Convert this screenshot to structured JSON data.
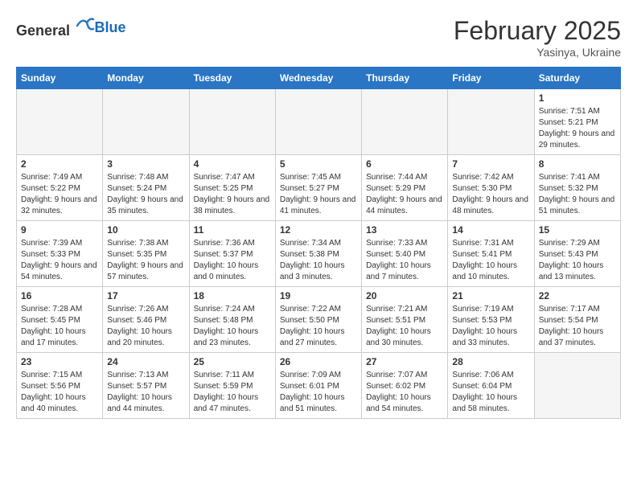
{
  "header": {
    "logo_general": "General",
    "logo_blue": "Blue",
    "title": "February 2025",
    "subtitle": "Yasinya, Ukraine"
  },
  "weekdays": [
    "Sunday",
    "Monday",
    "Tuesday",
    "Wednesday",
    "Thursday",
    "Friday",
    "Saturday"
  ],
  "weeks": [
    [
      {
        "day": "",
        "info": ""
      },
      {
        "day": "",
        "info": ""
      },
      {
        "day": "",
        "info": ""
      },
      {
        "day": "",
        "info": ""
      },
      {
        "day": "",
        "info": ""
      },
      {
        "day": "",
        "info": ""
      },
      {
        "day": "1",
        "info": "Sunrise: 7:51 AM\nSunset: 5:21 PM\nDaylight: 9 hours and 29 minutes."
      }
    ],
    [
      {
        "day": "2",
        "info": "Sunrise: 7:49 AM\nSunset: 5:22 PM\nDaylight: 9 hours and 32 minutes."
      },
      {
        "day": "3",
        "info": "Sunrise: 7:48 AM\nSunset: 5:24 PM\nDaylight: 9 hours and 35 minutes."
      },
      {
        "day": "4",
        "info": "Sunrise: 7:47 AM\nSunset: 5:25 PM\nDaylight: 9 hours and 38 minutes."
      },
      {
        "day": "5",
        "info": "Sunrise: 7:45 AM\nSunset: 5:27 PM\nDaylight: 9 hours and 41 minutes."
      },
      {
        "day": "6",
        "info": "Sunrise: 7:44 AM\nSunset: 5:29 PM\nDaylight: 9 hours and 44 minutes."
      },
      {
        "day": "7",
        "info": "Sunrise: 7:42 AM\nSunset: 5:30 PM\nDaylight: 9 hours and 48 minutes."
      },
      {
        "day": "8",
        "info": "Sunrise: 7:41 AM\nSunset: 5:32 PM\nDaylight: 9 hours and 51 minutes."
      }
    ],
    [
      {
        "day": "9",
        "info": "Sunrise: 7:39 AM\nSunset: 5:33 PM\nDaylight: 9 hours and 54 minutes."
      },
      {
        "day": "10",
        "info": "Sunrise: 7:38 AM\nSunset: 5:35 PM\nDaylight: 9 hours and 57 minutes."
      },
      {
        "day": "11",
        "info": "Sunrise: 7:36 AM\nSunset: 5:37 PM\nDaylight: 10 hours and 0 minutes."
      },
      {
        "day": "12",
        "info": "Sunrise: 7:34 AM\nSunset: 5:38 PM\nDaylight: 10 hours and 3 minutes."
      },
      {
        "day": "13",
        "info": "Sunrise: 7:33 AM\nSunset: 5:40 PM\nDaylight: 10 hours and 7 minutes."
      },
      {
        "day": "14",
        "info": "Sunrise: 7:31 AM\nSunset: 5:41 PM\nDaylight: 10 hours and 10 minutes."
      },
      {
        "day": "15",
        "info": "Sunrise: 7:29 AM\nSunset: 5:43 PM\nDaylight: 10 hours and 13 minutes."
      }
    ],
    [
      {
        "day": "16",
        "info": "Sunrise: 7:28 AM\nSunset: 5:45 PM\nDaylight: 10 hours and 17 minutes."
      },
      {
        "day": "17",
        "info": "Sunrise: 7:26 AM\nSunset: 5:46 PM\nDaylight: 10 hours and 20 minutes."
      },
      {
        "day": "18",
        "info": "Sunrise: 7:24 AM\nSunset: 5:48 PM\nDaylight: 10 hours and 23 minutes."
      },
      {
        "day": "19",
        "info": "Sunrise: 7:22 AM\nSunset: 5:50 PM\nDaylight: 10 hours and 27 minutes."
      },
      {
        "day": "20",
        "info": "Sunrise: 7:21 AM\nSunset: 5:51 PM\nDaylight: 10 hours and 30 minutes."
      },
      {
        "day": "21",
        "info": "Sunrise: 7:19 AM\nSunset: 5:53 PM\nDaylight: 10 hours and 33 minutes."
      },
      {
        "day": "22",
        "info": "Sunrise: 7:17 AM\nSunset: 5:54 PM\nDaylight: 10 hours and 37 minutes."
      }
    ],
    [
      {
        "day": "23",
        "info": "Sunrise: 7:15 AM\nSunset: 5:56 PM\nDaylight: 10 hours and 40 minutes."
      },
      {
        "day": "24",
        "info": "Sunrise: 7:13 AM\nSunset: 5:57 PM\nDaylight: 10 hours and 44 minutes."
      },
      {
        "day": "25",
        "info": "Sunrise: 7:11 AM\nSunset: 5:59 PM\nDaylight: 10 hours and 47 minutes."
      },
      {
        "day": "26",
        "info": "Sunrise: 7:09 AM\nSunset: 6:01 PM\nDaylight: 10 hours and 51 minutes."
      },
      {
        "day": "27",
        "info": "Sunrise: 7:07 AM\nSunset: 6:02 PM\nDaylight: 10 hours and 54 minutes."
      },
      {
        "day": "28",
        "info": "Sunrise: 7:06 AM\nSunset: 6:04 PM\nDaylight: 10 hours and 58 minutes."
      },
      {
        "day": "",
        "info": ""
      }
    ]
  ]
}
